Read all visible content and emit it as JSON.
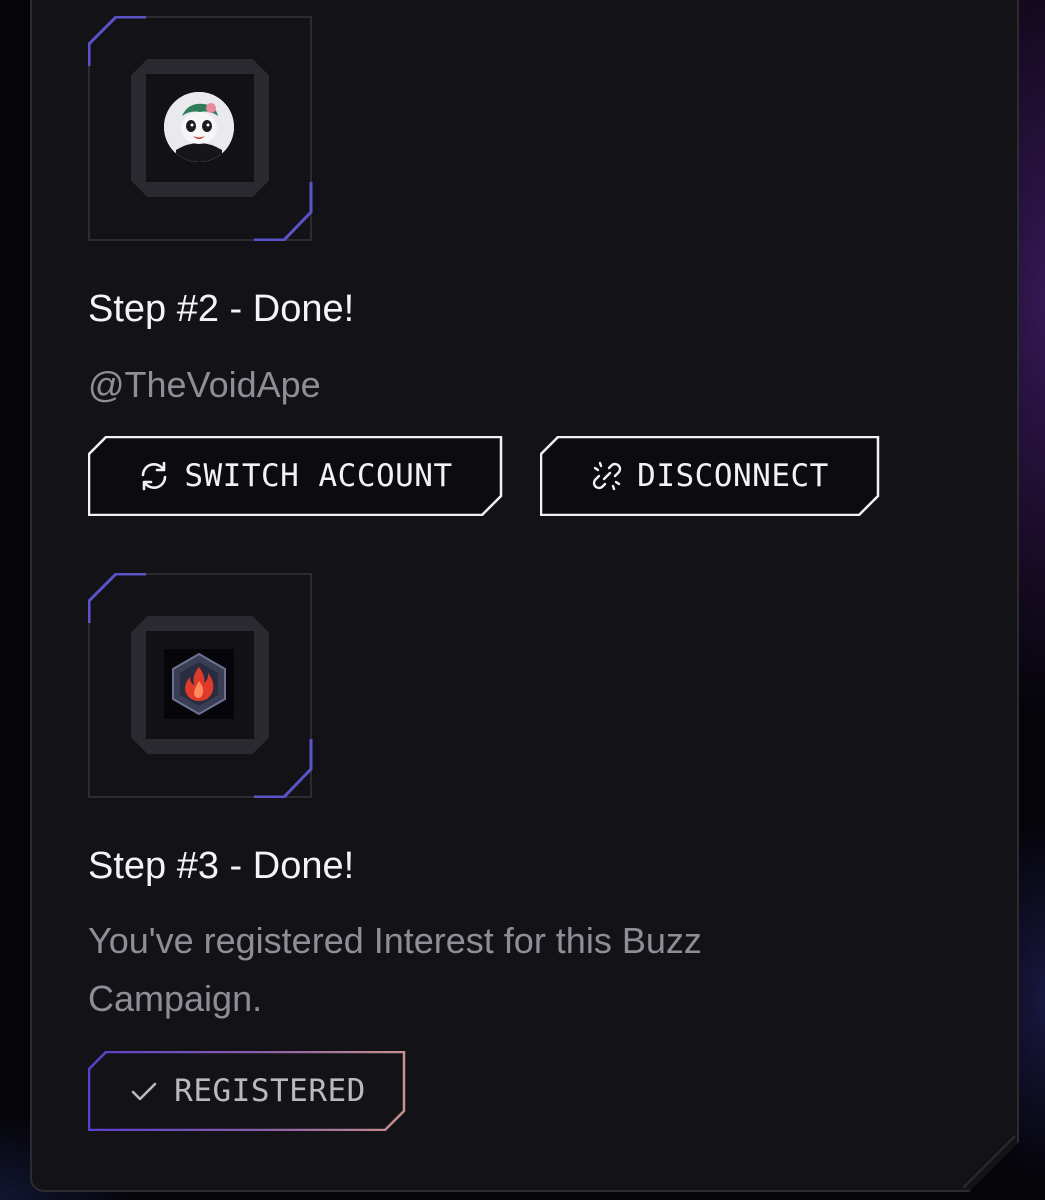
{
  "step2": {
    "title": "Step #2 - Done!",
    "handle": "@TheVoidApe",
    "avatar_icon": "panda-avatar-icon",
    "buttons": {
      "switch_account": {
        "label": "SWITCH ACCOUNT",
        "icon": "refresh-icon"
      },
      "disconnect": {
        "label": "DISCONNECT",
        "icon": "broken-link-icon"
      }
    }
  },
  "step3": {
    "title": "Step #3 - Done!",
    "description": "You've registered Interest for this Buzz Campaign.",
    "token_icon": "flame-hexagon-icon",
    "registered_button": {
      "label": "REGISTERED",
      "icon": "check-icon"
    }
  },
  "colors": {
    "card_background": "#121217",
    "accent_purple": "#5b54c9",
    "gradient_end": "#c8908e",
    "text_primary": "#f4f4f6",
    "text_secondary": "#8e8e96"
  }
}
